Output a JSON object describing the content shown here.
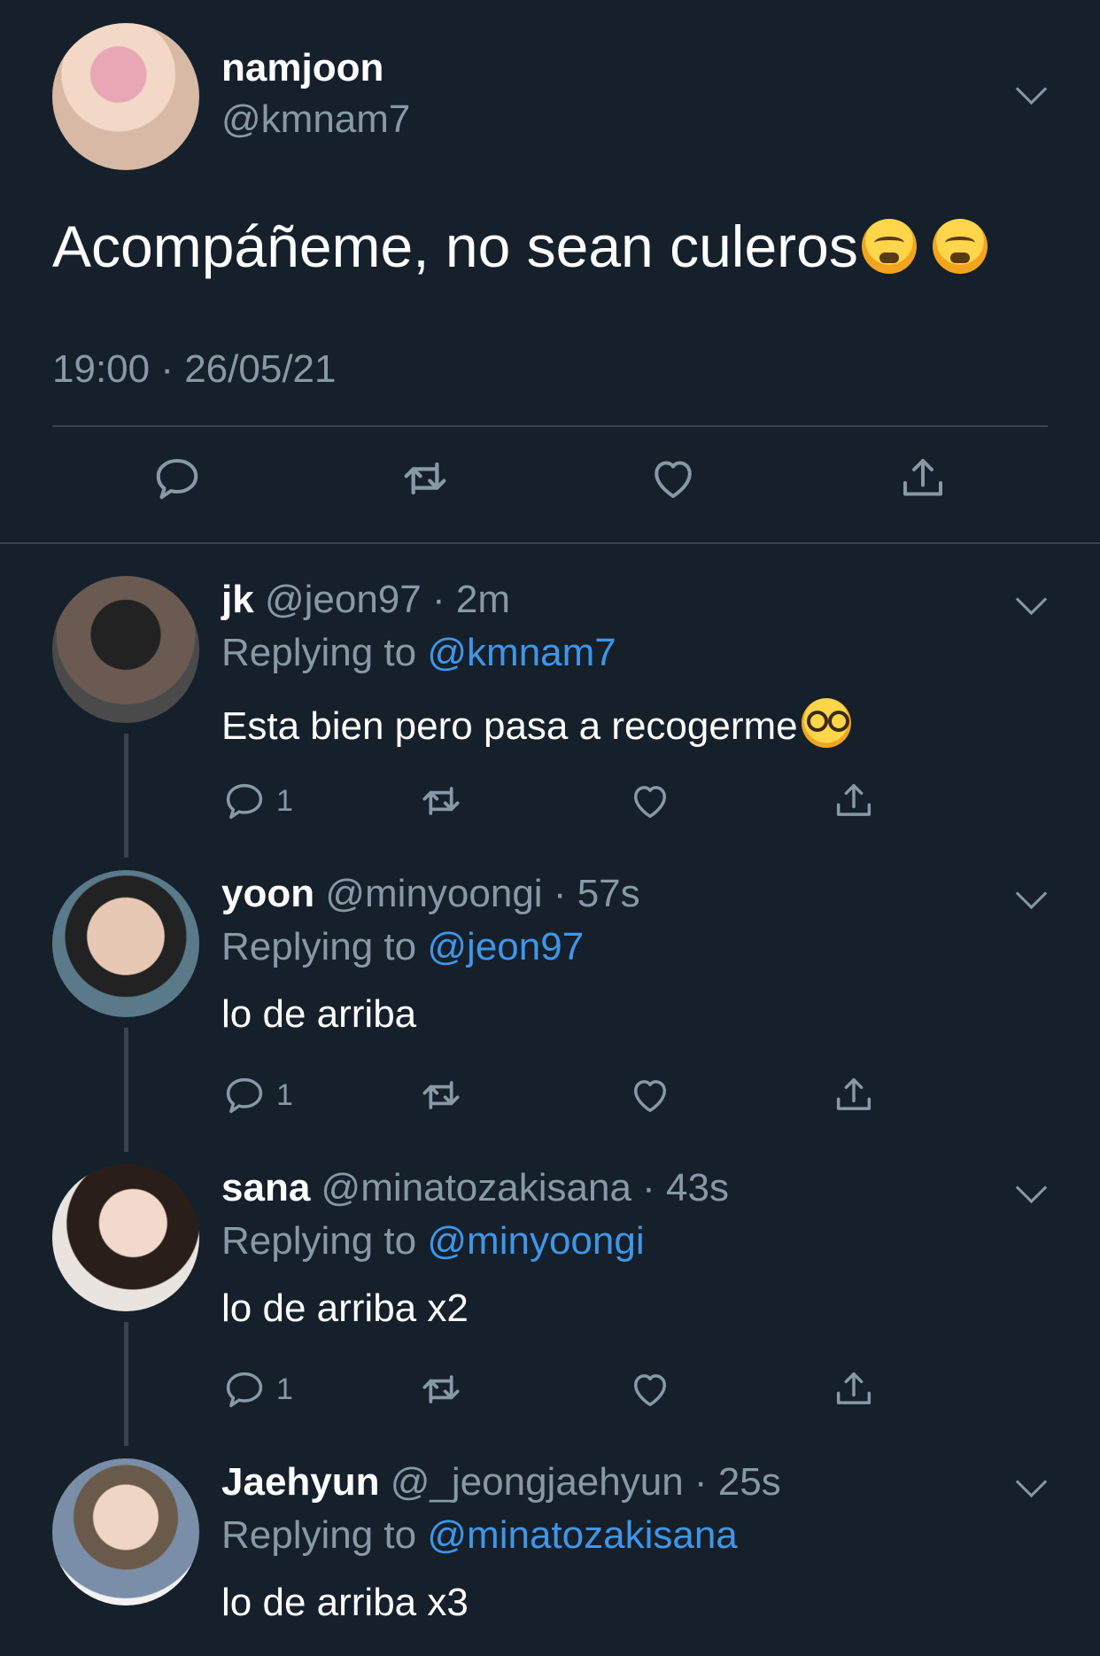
{
  "main_tweet": {
    "name": "namjoon",
    "handle": "@kmnam7",
    "text": "Acompáñeme, no sean culeros",
    "emoji": [
      "tired-face-emoji",
      "tired-face-emoji"
    ],
    "timestamp": "19:00 · 26/05/21"
  },
  "replies": [
    {
      "name": "jk",
      "handle": "@jeon97",
      "time": "· 2m",
      "replying_prefix": "Replying to",
      "replying_to": "@kmnam7",
      "text": "Esta bien pero pasa a recogerme",
      "emoji": "nerd-face-emoji",
      "reply_count": "1"
    },
    {
      "name": "yoon",
      "handle": "@minyoongi",
      "time": "· 57s",
      "replying_prefix": "Replying to",
      "replying_to": "@jeon97",
      "text": "lo de arriba",
      "reply_count": "1"
    },
    {
      "name": "sana",
      "handle": "@minatozakisana",
      "time": "· 43s",
      "replying_prefix": "Replying to",
      "replying_to": "@minyoongi",
      "text": "lo de arriba x2",
      "reply_count": "1"
    },
    {
      "name": "Jaehyun",
      "handle": "@_jeongjaehyun",
      "time": "· 25s",
      "replying_prefix": "Replying to",
      "replying_to": "@minatozakisana",
      "text": "lo de arriba x3"
    }
  ],
  "colors": {
    "background": "#15202b",
    "secondary_text": "#8899a6",
    "mention": "#3f96e8",
    "divider": "#38444d"
  }
}
